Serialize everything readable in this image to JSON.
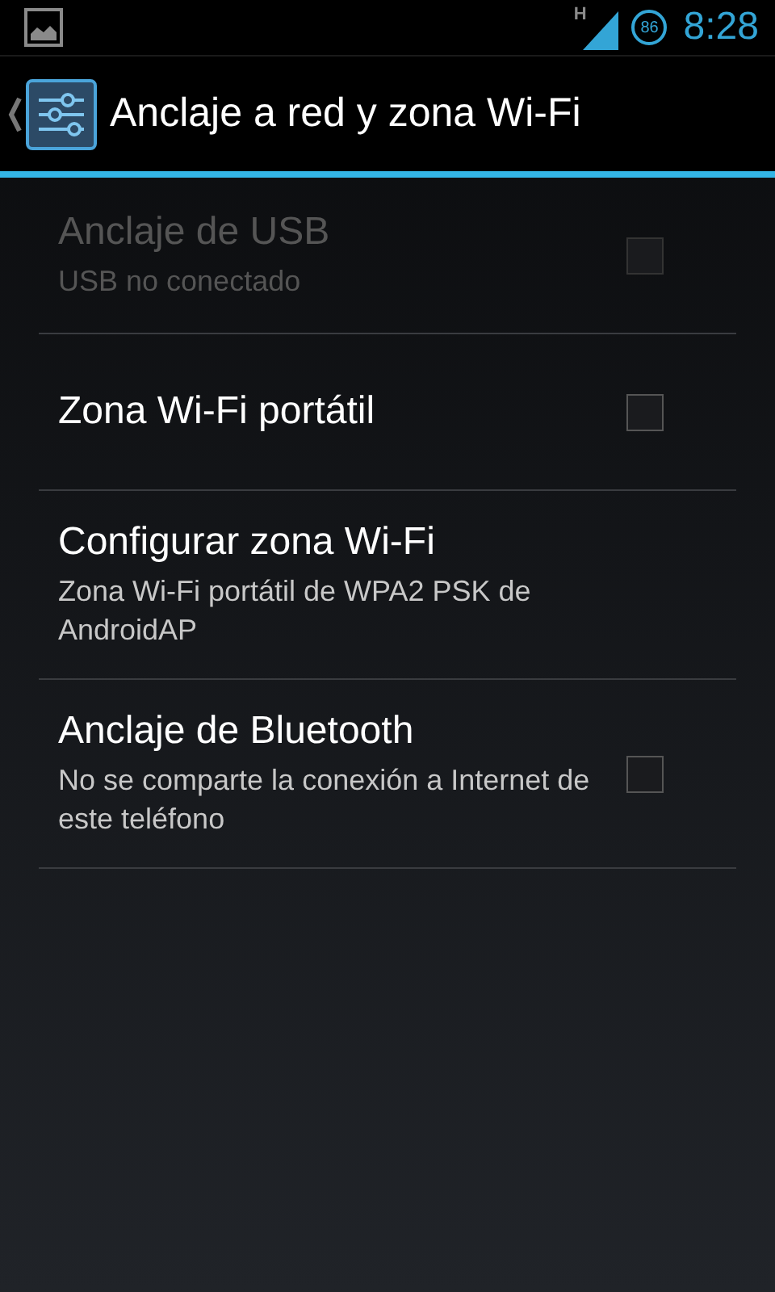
{
  "status_bar": {
    "network": "H",
    "battery": "86",
    "time": "8:28"
  },
  "action_bar": {
    "title": "Anclaje a red y zona Wi-Fi"
  },
  "items": [
    {
      "kind": "checkbox",
      "title": "Anclaje de USB",
      "summary": "USB no conectado",
      "disabled": true,
      "checked": false
    },
    {
      "kind": "checkbox",
      "title": "Zona Wi-Fi portátil",
      "disabled": false,
      "checked": false
    },
    {
      "kind": "link",
      "title": "Configurar zona Wi-Fi",
      "summary": "Zona Wi-Fi portátil de WPA2 PSK de AndroidAP",
      "disabled": false
    },
    {
      "kind": "checkbox",
      "title": "Anclaje de Bluetooth",
      "summary": "No se comparte la conexión a Internet de este teléfono",
      "disabled": false,
      "checked": false
    }
  ]
}
